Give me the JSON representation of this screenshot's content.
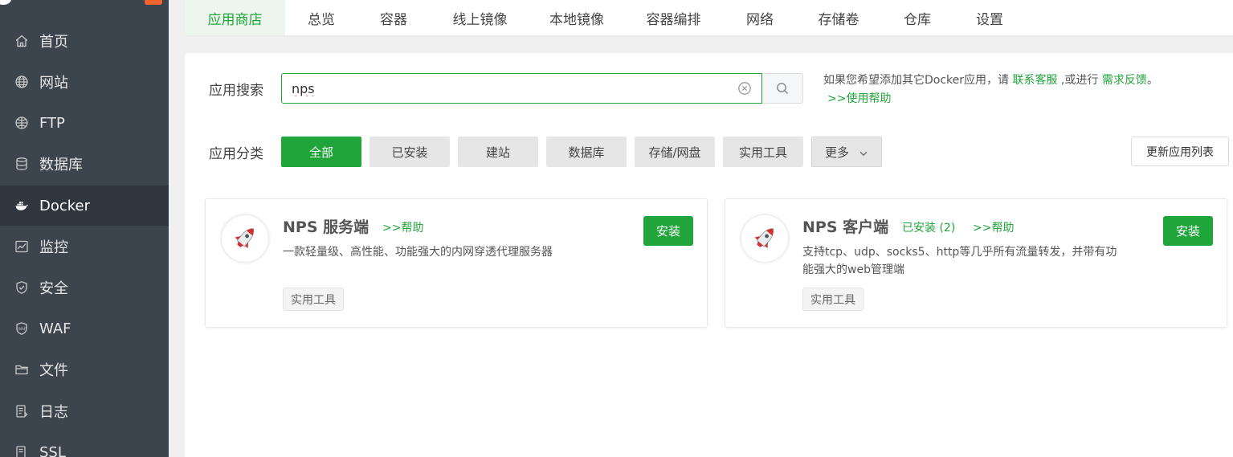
{
  "sidebar": {
    "items": [
      {
        "label": "首页",
        "icon": "home-icon"
      },
      {
        "label": "网站",
        "icon": "globe-icon"
      },
      {
        "label": "FTP",
        "icon": "ftp-icon"
      },
      {
        "label": "数据库",
        "icon": "database-icon"
      },
      {
        "label": "Docker",
        "icon": "docker-icon",
        "active": true
      },
      {
        "label": "监控",
        "icon": "monitor-icon"
      },
      {
        "label": "安全",
        "icon": "shield-icon"
      },
      {
        "label": "WAF",
        "icon": "waf-icon"
      },
      {
        "label": "文件",
        "icon": "folder-icon"
      },
      {
        "label": "日志",
        "icon": "log-icon"
      },
      {
        "label": "SSL",
        "icon": "ssl-icon"
      }
    ]
  },
  "tabs": [
    {
      "label": "应用商店",
      "active": true
    },
    {
      "label": "总览"
    },
    {
      "label": "容器"
    },
    {
      "label": "线上镜像"
    },
    {
      "label": "本地镜像"
    },
    {
      "label": "容器编排"
    },
    {
      "label": "网络"
    },
    {
      "label": "存储卷"
    },
    {
      "label": "仓库"
    },
    {
      "label": "设置"
    }
  ],
  "search": {
    "label": "应用搜索",
    "value": "nps",
    "hint_prefix": "如果您希望添加其它Docker应用，请 ",
    "hint_contact": "联系客服",
    "hint_middle": " ,或进行 ",
    "hint_feedback": "需求反馈",
    "hint_suffix": "。",
    "help_link": ">>使用帮助"
  },
  "categories": {
    "label": "应用分类",
    "items": [
      "全部",
      "已安装",
      "建站",
      "数据库",
      "存储/网盘",
      "实用工具",
      "更多"
    ],
    "refresh_label": "更新应用列表"
  },
  "apps": [
    {
      "name": "NPS 服务端",
      "help": ">>帮助",
      "installed": "",
      "desc_line1": "一款轻量级、高性能、功能强大的内网穿透代理服务器",
      "desc_line2": "",
      "tag": "实用工具",
      "install_label": "安装"
    },
    {
      "name": "NPS 客户端",
      "help": ">>帮助",
      "installed": "已安装 (2)",
      "desc_line1": "支持tcp、udp、socks5、http等几乎所有流量转发，并带有功",
      "desc_line2": "能强大的web管理端",
      "tag": "实用工具",
      "install_label": "安装"
    }
  ],
  "colors": {
    "accent": "#20a53a",
    "sidebar_bg": "#3c444d",
    "sidebar_active": "#2f363e"
  }
}
